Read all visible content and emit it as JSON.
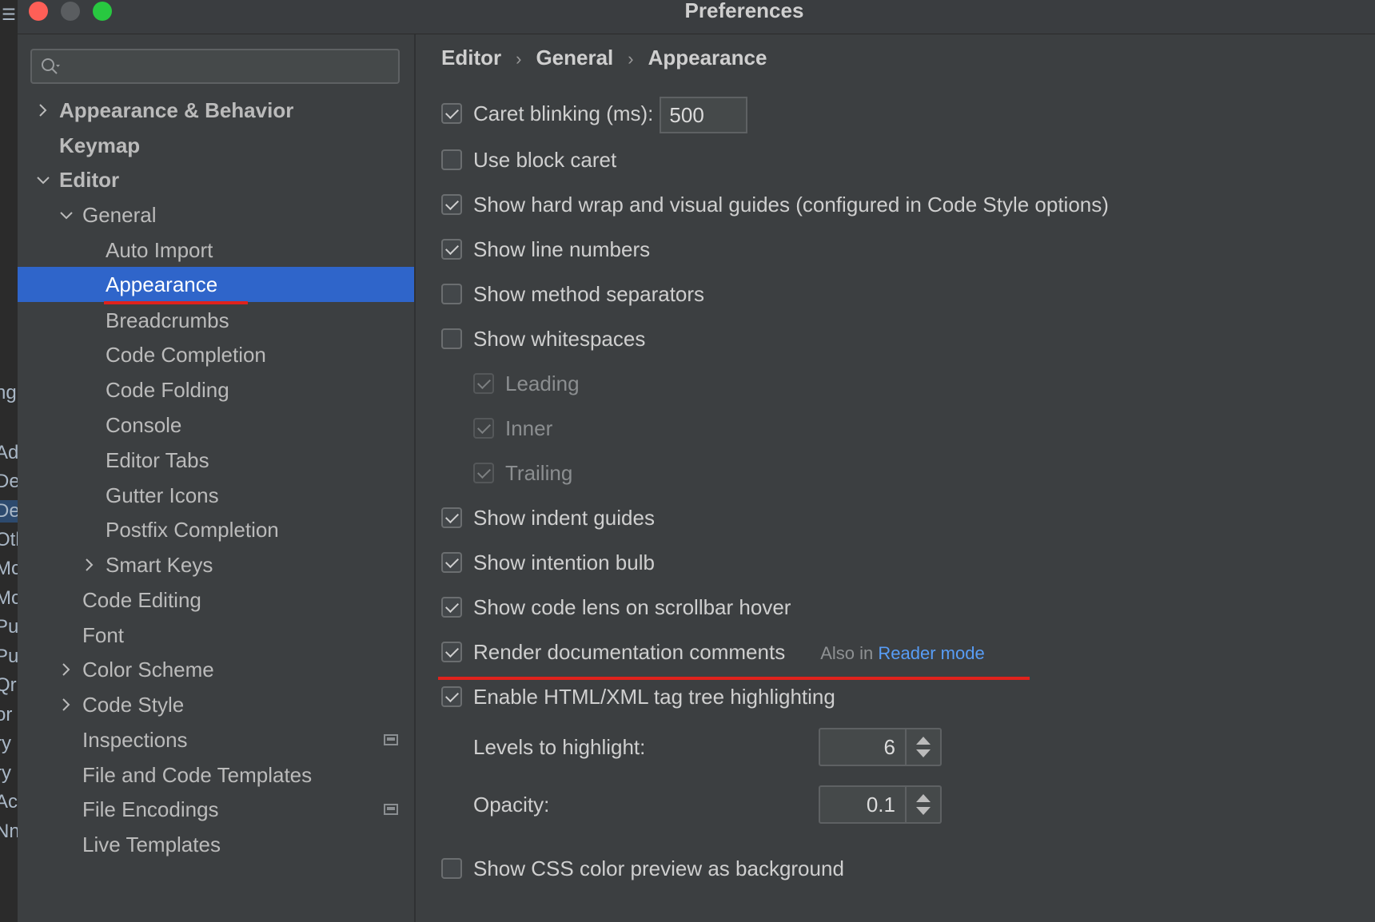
{
  "window": {
    "title": "Preferences"
  },
  "left_sliver_fragments": [
    "ng",
    "Ad",
    "De",
    "De",
    "Otl",
    "Mc",
    "Mc",
    "Pu",
    "Pu",
    "Qr",
    "or",
    "ry",
    "ry",
    "Ac",
    "Nn"
  ],
  "search": {
    "value": "",
    "placeholder": ""
  },
  "sidebar": {
    "items": [
      {
        "label": "Appearance & Behavior",
        "expander": "collapsed"
      },
      {
        "label": "Keymap"
      },
      {
        "label": "Editor",
        "expander": "expanded"
      },
      {
        "label": "General",
        "expander": "expanded"
      },
      {
        "label": "Auto Import"
      },
      {
        "label": "Appearance",
        "selected": true
      },
      {
        "label": "Breadcrumbs"
      },
      {
        "label": "Code Completion"
      },
      {
        "label": "Code Folding"
      },
      {
        "label": "Console"
      },
      {
        "label": "Editor Tabs"
      },
      {
        "label": "Gutter Icons"
      },
      {
        "label": "Postfix Completion"
      },
      {
        "label": "Smart Keys",
        "expander": "collapsed"
      },
      {
        "label": "Code Editing"
      },
      {
        "label": "Font"
      },
      {
        "label": "Color Scheme",
        "expander": "collapsed"
      },
      {
        "label": "Code Style",
        "expander": "collapsed"
      },
      {
        "label": "Inspections",
        "icon": "project-settings-icon"
      },
      {
        "label": "File and Code Templates"
      },
      {
        "label": "File Encodings",
        "icon": "project-settings-icon"
      },
      {
        "label": "Live Templates"
      }
    ]
  },
  "breadcrumb": [
    "Editor",
    "General",
    "Appearance"
  ],
  "options": {
    "caret_blinking": {
      "label": "Caret blinking (ms):",
      "checked": true,
      "value": "500"
    },
    "use_block_caret": {
      "label": "Use block caret",
      "checked": false
    },
    "hard_wrap": {
      "label": "Show hard wrap and visual guides (configured in Code Style options)",
      "checked": true
    },
    "line_numbers": {
      "label": "Show line numbers",
      "checked": true
    },
    "method_separators": {
      "label": "Show method separators",
      "checked": false
    },
    "whitespaces": {
      "label": "Show whitespaces",
      "checked": false
    },
    "leading": {
      "label": "Leading",
      "checked": true,
      "disabled": true
    },
    "inner": {
      "label": "Inner",
      "checked": true,
      "disabled": true
    },
    "trailing": {
      "label": "Trailing",
      "checked": true,
      "disabled": true
    },
    "indent_guides": {
      "label": "Show indent guides",
      "checked": true
    },
    "intention_bulb": {
      "label": "Show intention bulb",
      "checked": true
    },
    "code_lens": {
      "label": "Show code lens on scrollbar hover",
      "checked": true
    },
    "render_docs": {
      "label": "Render documentation comments",
      "checked": true,
      "also_in": "Also in",
      "link": "Reader mode"
    },
    "html_xml": {
      "label": "Enable HTML/XML tag tree highlighting",
      "checked": true
    },
    "levels": {
      "label": "Levels to highlight:",
      "value": "6"
    },
    "opacity": {
      "label": "Opacity:",
      "value": "0.1"
    },
    "css_color": {
      "label": "Show CSS color preview as background",
      "checked": false
    }
  },
  "colors": {
    "selection": "#2f65ca",
    "annotation_red": "#e0221c",
    "link": "#589df6"
  }
}
